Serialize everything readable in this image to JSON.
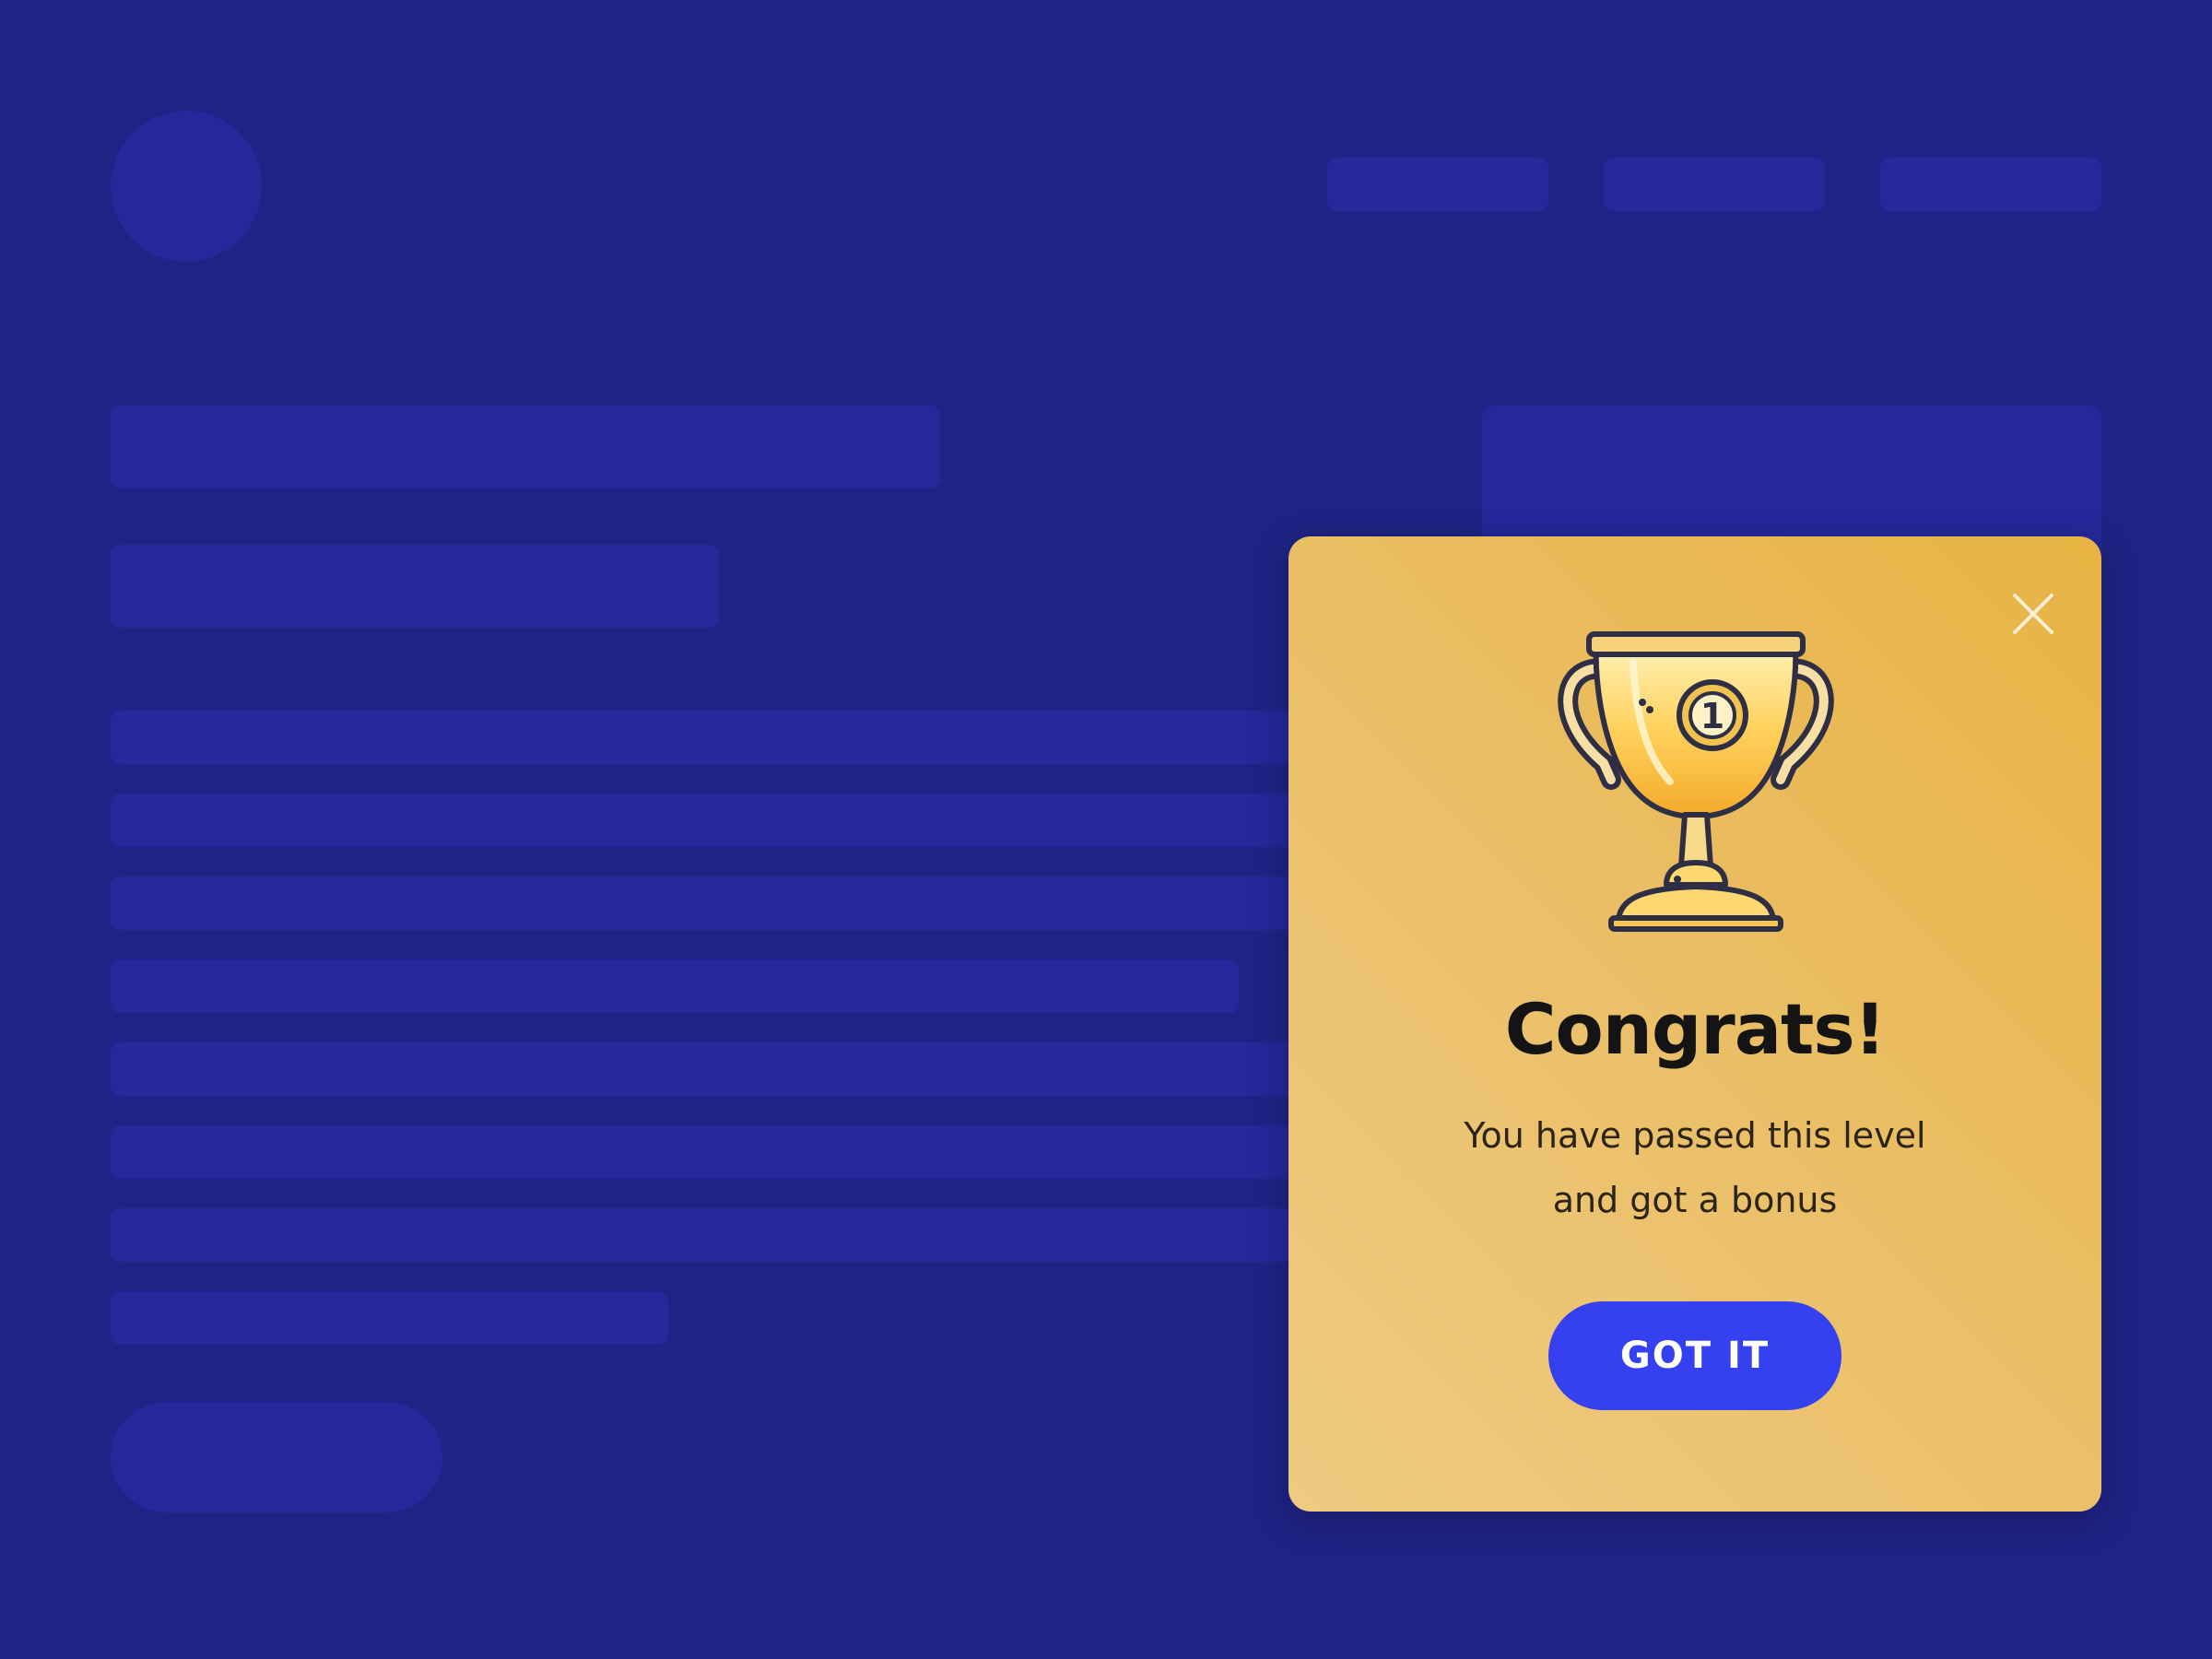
{
  "colors": {
    "page_background": "#1f2385",
    "placeholder": "#24289a",
    "modal_gradient_start": "#e8b343",
    "modal_gradient_end": "#eecb82",
    "button": "#3540f0",
    "button_text": "#ffffff",
    "title_text": "#141414"
  },
  "modal": {
    "close_icon": "close-icon",
    "trophy_icon": "trophy-icon",
    "trophy_badge": "1",
    "title": "Congrats!",
    "message_line1": "You have passed this level",
    "message_line2": "and got a bonus",
    "button_label": "GOT IT"
  }
}
